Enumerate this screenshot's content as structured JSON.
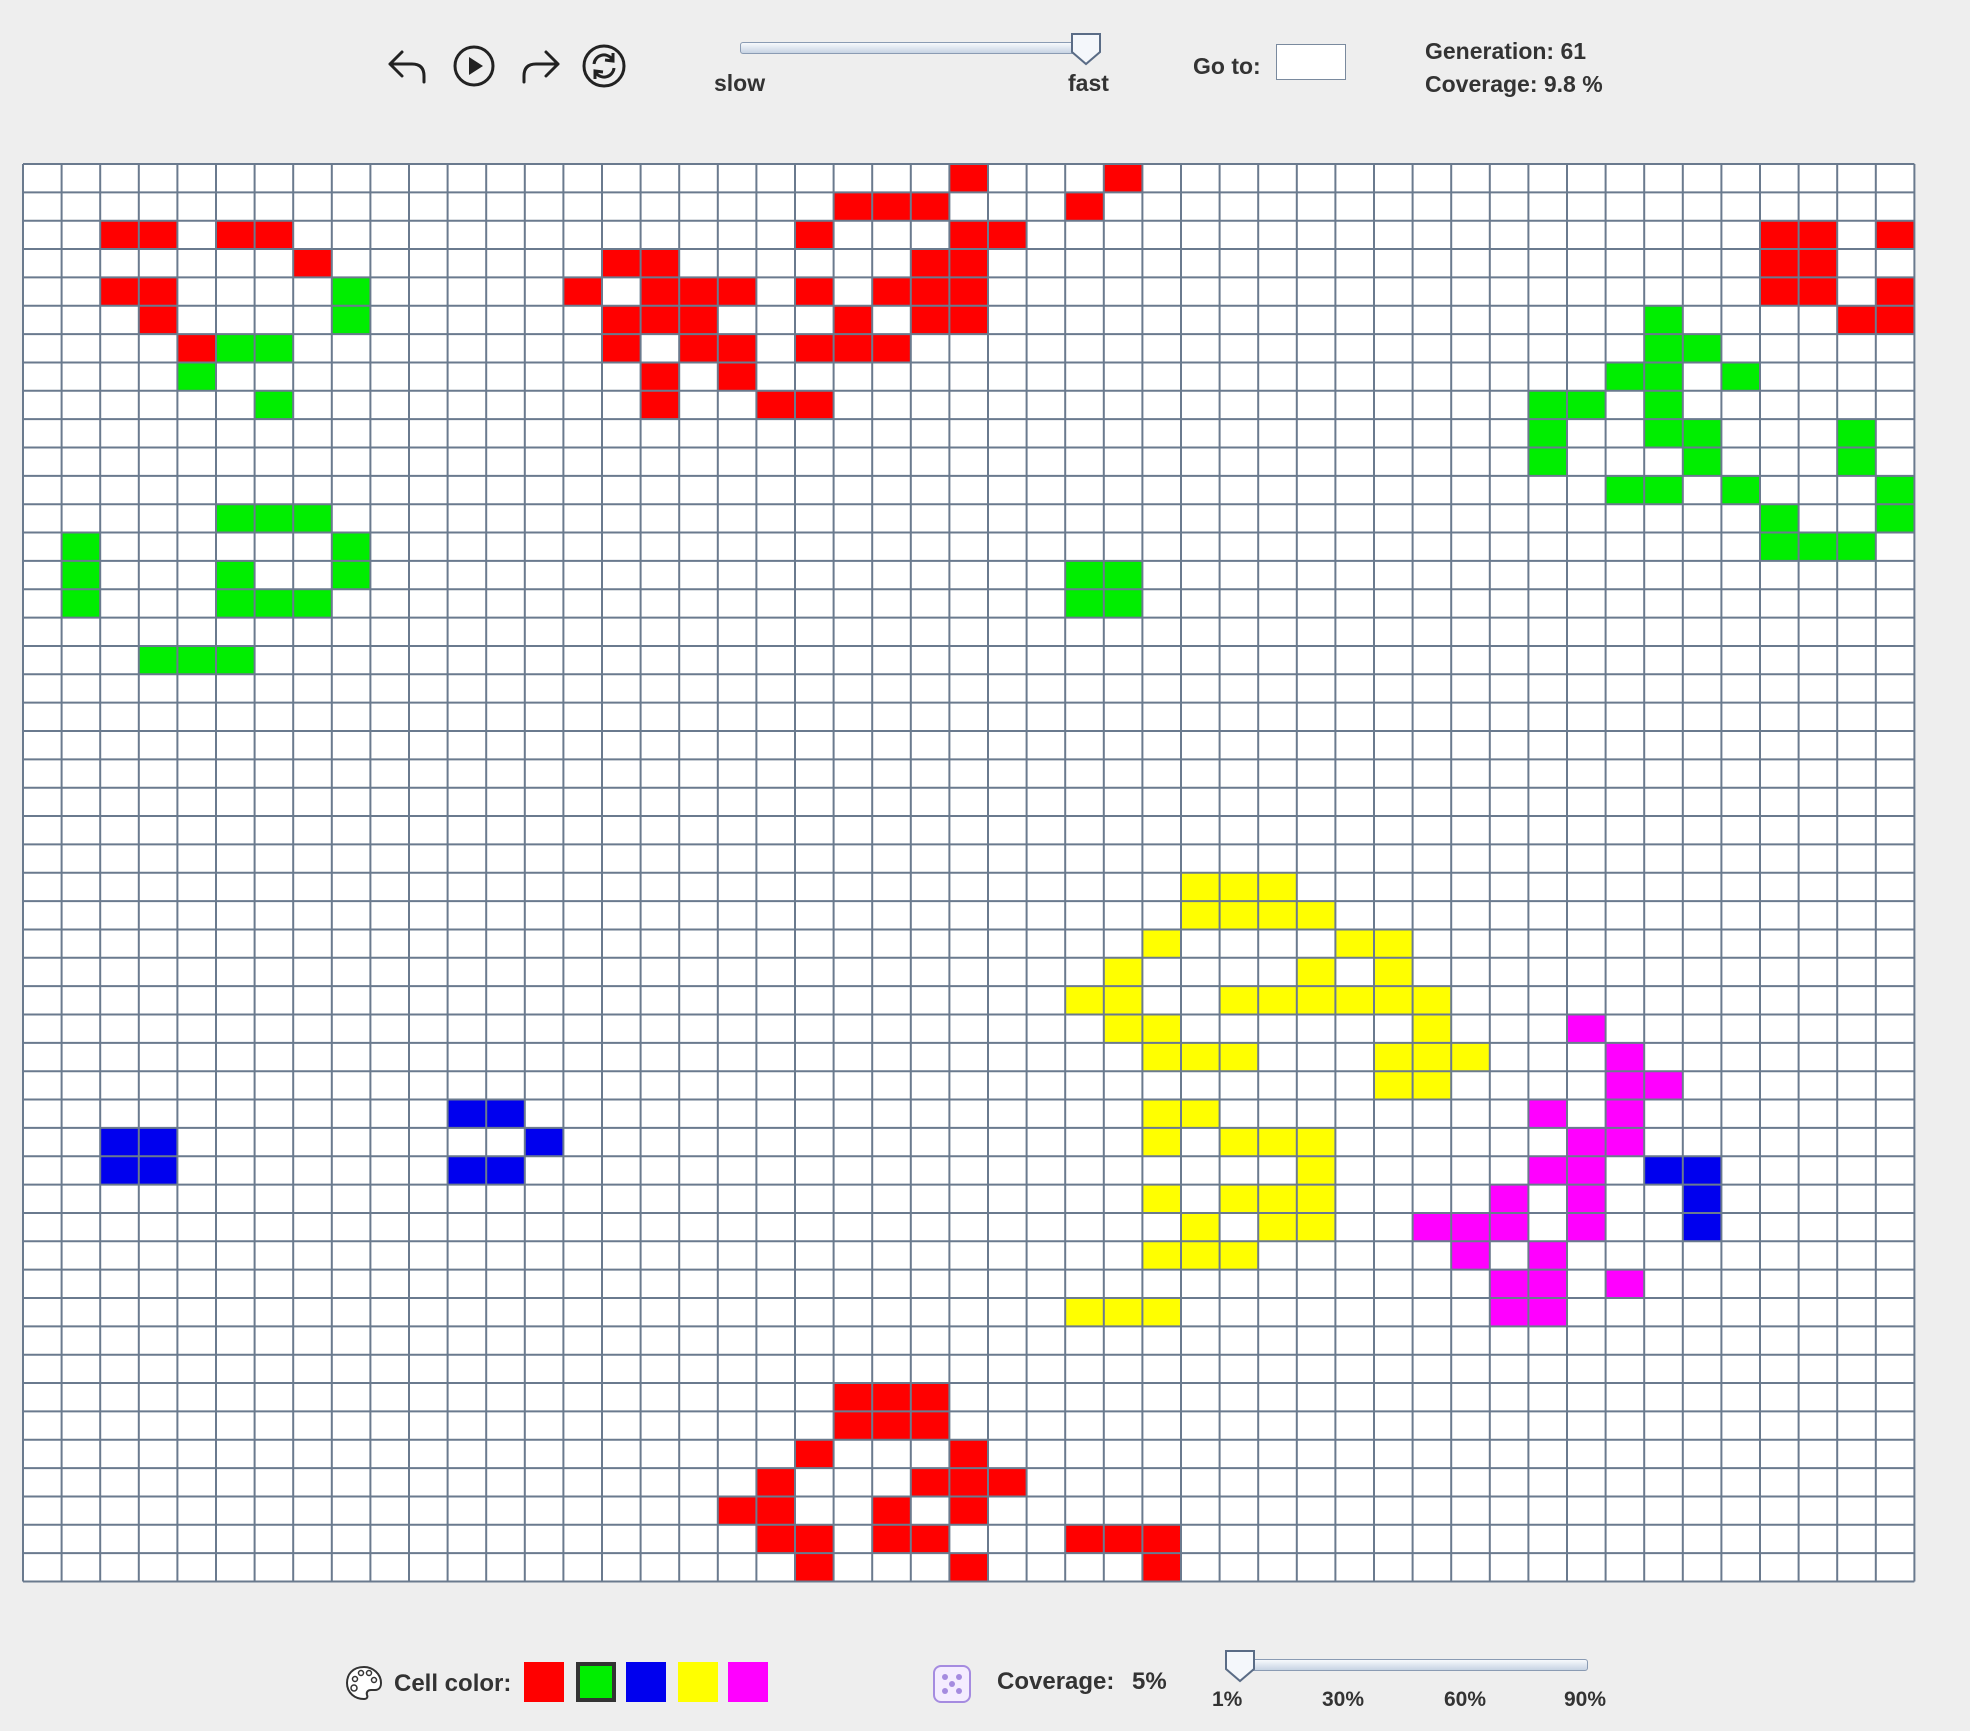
{
  "toolbar": {
    "speed_slow_label": "slow",
    "speed_fast_label": "fast",
    "speed_value": 1.0,
    "goto_label": "Go to:",
    "goto_value": "",
    "generation_text": "Generation: 61",
    "coverage_text": "Coverage: 9.8 %"
  },
  "grid": {
    "cols": 49,
    "rows": 50,
    "line_color": "#6a7a8e",
    "background": "#ffffff",
    "colors": {
      "R": "#ff0000",
      "G": "#00ee00",
      "B": "#0000ee",
      "Y": "#ffff00",
      "M": "#ff00ff"
    },
    "cells": {
      "R": [
        [
          0,
          24
        ],
        [
          0,
          28
        ],
        [
          1,
          21
        ],
        [
          1,
          22
        ],
        [
          1,
          23
        ],
        [
          1,
          27
        ],
        [
          2,
          2
        ],
        [
          2,
          3
        ],
        [
          2,
          5
        ],
        [
          2,
          6
        ],
        [
          2,
          20
        ],
        [
          2,
          24
        ],
        [
          2,
          25
        ],
        [
          2,
          45
        ],
        [
          2,
          46
        ],
        [
          2,
          48
        ],
        [
          3,
          7
        ],
        [
          3,
          15
        ],
        [
          3,
          16
        ],
        [
          3,
          23
        ],
        [
          3,
          24
        ],
        [
          3,
          45
        ],
        [
          3,
          46
        ],
        [
          4,
          2
        ],
        [
          4,
          3
        ],
        [
          4,
          14
        ],
        [
          4,
          16
        ],
        [
          4,
          17
        ],
        [
          4,
          18
        ],
        [
          4,
          20
        ],
        [
          4,
          22
        ],
        [
          4,
          23
        ],
        [
          4,
          24
        ],
        [
          4,
          45
        ],
        [
          4,
          46
        ],
        [
          4,
          48
        ],
        [
          5,
          3
        ],
        [
          5,
          15
        ],
        [
          5,
          16
        ],
        [
          5,
          17
        ],
        [
          5,
          21
        ],
        [
          5,
          23
        ],
        [
          5,
          24
        ],
        [
          5,
          47
        ],
        [
          5,
          48
        ],
        [
          6,
          4
        ],
        [
          6,
          15
        ],
        [
          6,
          17
        ],
        [
          6,
          18
        ],
        [
          6,
          20
        ],
        [
          6,
          21
        ],
        [
          6,
          22
        ],
        [
          7,
          16
        ],
        [
          7,
          18
        ],
        [
          8,
          16
        ],
        [
          8,
          19
        ],
        [
          8,
          20
        ],
        [
          43,
          21
        ],
        [
          43,
          22
        ],
        [
          43,
          23
        ],
        [
          44,
          21
        ],
        [
          44,
          22
        ],
        [
          44,
          23
        ],
        [
          45,
          20
        ],
        [
          45,
          24
        ],
        [
          46,
          19
        ],
        [
          46,
          23
        ],
        [
          46,
          24
        ],
        [
          46,
          25
        ],
        [
          47,
          18
        ],
        [
          47,
          19
        ],
        [
          47,
          22
        ],
        [
          47,
          24
        ],
        [
          48,
          19
        ],
        [
          48,
          20
        ],
        [
          48,
          22
        ],
        [
          48,
          23
        ],
        [
          48,
          27
        ],
        [
          48,
          28
        ],
        [
          48,
          29
        ],
        [
          49,
          20
        ],
        [
          49,
          24
        ],
        [
          49,
          29
        ]
      ],
      "G": [
        [
          4,
          8
        ],
        [
          5,
          8
        ],
        [
          5,
          42
        ],
        [
          6,
          5
        ],
        [
          6,
          6
        ],
        [
          6,
          42
        ],
        [
          6,
          43
        ],
        [
          7,
          4
        ],
        [
          7,
          41
        ],
        [
          7,
          42
        ],
        [
          7,
          44
        ],
        [
          8,
          6
        ],
        [
          8,
          39
        ],
        [
          8,
          40
        ],
        [
          8,
          42
        ],
        [
          9,
          39
        ],
        [
          9,
          42
        ],
        [
          9,
          43
        ],
        [
          9,
          47
        ],
        [
          10,
          39
        ],
        [
          10,
          43
        ],
        [
          10,
          47
        ],
        [
          11,
          41
        ],
        [
          11,
          42
        ],
        [
          11,
          44
        ],
        [
          11,
          48
        ],
        [
          12,
          5
        ],
        [
          12,
          6
        ],
        [
          12,
          7
        ],
        [
          12,
          45
        ],
        [
          12,
          48
        ],
        [
          13,
          1
        ],
        [
          13,
          8
        ],
        [
          13,
          45
        ],
        [
          13,
          46
        ],
        [
          13,
          47
        ],
        [
          14,
          1
        ],
        [
          14,
          5
        ],
        [
          14,
          8
        ],
        [
          14,
          27
        ],
        [
          14,
          28
        ],
        [
          15,
          1
        ],
        [
          15,
          5
        ],
        [
          15,
          6
        ],
        [
          15,
          7
        ],
        [
          15,
          27
        ],
        [
          15,
          28
        ],
        [
          17,
          3
        ],
        [
          17,
          4
        ],
        [
          17,
          5
        ]
      ],
      "B": [
        [
          33,
          11
        ],
        [
          33,
          12
        ],
        [
          34,
          2
        ],
        [
          34,
          3
        ],
        [
          34,
          13
        ],
        [
          35,
          2
        ],
        [
          35,
          3
        ],
        [
          35,
          11
        ],
        [
          35,
          12
        ],
        [
          35,
          42
        ],
        [
          35,
          43
        ],
        [
          36,
          43
        ],
        [
          37,
          43
        ]
      ],
      "Y": [
        [
          25,
          30
        ],
        [
          25,
          31
        ],
        [
          25,
          32
        ],
        [
          26,
          30
        ],
        [
          26,
          31
        ],
        [
          26,
          32
        ],
        [
          26,
          33
        ],
        [
          27,
          29
        ],
        [
          27,
          34
        ],
        [
          27,
          35
        ],
        [
          28,
          28
        ],
        [
          28,
          33
        ],
        [
          28,
          35
        ],
        [
          29,
          27
        ],
        [
          29,
          28
        ],
        [
          29,
          31
        ],
        [
          29,
          32
        ],
        [
          29,
          33
        ],
        [
          29,
          34
        ],
        [
          29,
          35
        ],
        [
          29,
          36
        ],
        [
          30,
          28
        ],
        [
          30,
          29
        ],
        [
          30,
          36
        ],
        [
          31,
          29
        ],
        [
          31,
          30
        ],
        [
          31,
          31
        ],
        [
          31,
          35
        ],
        [
          31,
          36
        ],
        [
          31,
          37
        ],
        [
          32,
          35
        ],
        [
          32,
          36
        ],
        [
          33,
          29
        ],
        [
          33,
          30
        ],
        [
          34,
          29
        ],
        [
          34,
          31
        ],
        [
          34,
          32
        ],
        [
          34,
          33
        ],
        [
          35,
          33
        ],
        [
          36,
          29
        ],
        [
          36,
          31
        ],
        [
          36,
          32
        ],
        [
          36,
          33
        ],
        [
          37,
          30
        ],
        [
          37,
          32
        ],
        [
          37,
          33
        ],
        [
          38,
          29
        ],
        [
          38,
          30
        ],
        [
          38,
          31
        ],
        [
          40,
          27
        ],
        [
          40,
          28
        ],
        [
          40,
          29
        ]
      ],
      "M": [
        [
          30,
          40
        ],
        [
          31,
          41
        ],
        [
          32,
          41
        ],
        [
          32,
          42
        ],
        [
          33,
          39
        ],
        [
          33,
          41
        ],
        [
          34,
          40
        ],
        [
          34,
          41
        ],
        [
          35,
          39
        ],
        [
          35,
          40
        ],
        [
          36,
          38
        ],
        [
          36,
          40
        ],
        [
          37,
          36
        ],
        [
          37,
          37
        ],
        [
          37,
          38
        ],
        [
          37,
          40
        ],
        [
          38,
          37
        ],
        [
          38,
          39
        ],
        [
          39,
          38
        ],
        [
          39,
          39
        ],
        [
          39,
          41
        ],
        [
          40,
          38
        ],
        [
          40,
          39
        ]
      ]
    }
  },
  "bottom": {
    "cell_color_label": "Cell color:",
    "cell_colors": [
      "#ff0000",
      "#00ee00",
      "#0000ee",
      "#ffff00",
      "#ff00ff"
    ],
    "selected_color_index": 1,
    "coverage_label": "Coverage:",
    "coverage_value_text": "5%",
    "coverage_percent": 1,
    "ticks": [
      "1%",
      "30%",
      "60%",
      "90%"
    ]
  },
  "icons": [
    "undo-icon",
    "play-icon",
    "redo-icon",
    "reset-icon",
    "palette-icon",
    "dice-icon"
  ]
}
